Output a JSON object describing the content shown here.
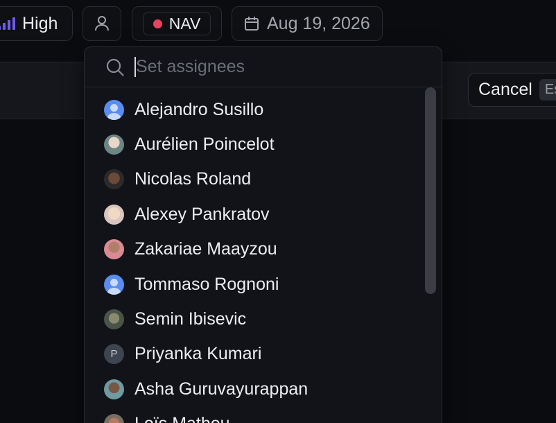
{
  "toolbar": {
    "priority_label": "High",
    "label_name": "NAV",
    "date": "Aug 19, 2026"
  },
  "editor": {
    "cancel_label": "Cancel",
    "cancel_shortcut": "Es"
  },
  "dropdown": {
    "search_placeholder": "Set assignees",
    "assignees": [
      {
        "name": "Alejandro Susillo",
        "avatar": "generic"
      },
      {
        "name": "Aurélien Poincelot",
        "avatar": "photo-1"
      },
      {
        "name": "Nicolas Roland",
        "avatar": "photo-2"
      },
      {
        "name": "Alexey Pankratov",
        "avatar": "photo-3"
      },
      {
        "name": "Zakariae Maayzou",
        "avatar": "photo-4"
      },
      {
        "name": "Tommaso Rognoni",
        "avatar": "generic"
      },
      {
        "name": "Semin Ibisevic",
        "avatar": "photo-5"
      },
      {
        "name": "Priyanka Kumari",
        "avatar": "initial",
        "initial": "P"
      },
      {
        "name": "Asha Guruvayurappan",
        "avatar": "photo-6"
      },
      {
        "name": "Loïs Mathou",
        "avatar": "photo-7"
      }
    ]
  },
  "colors": {
    "priority_bars": "#6f5bf0",
    "label_dot": "#e8435e"
  }
}
